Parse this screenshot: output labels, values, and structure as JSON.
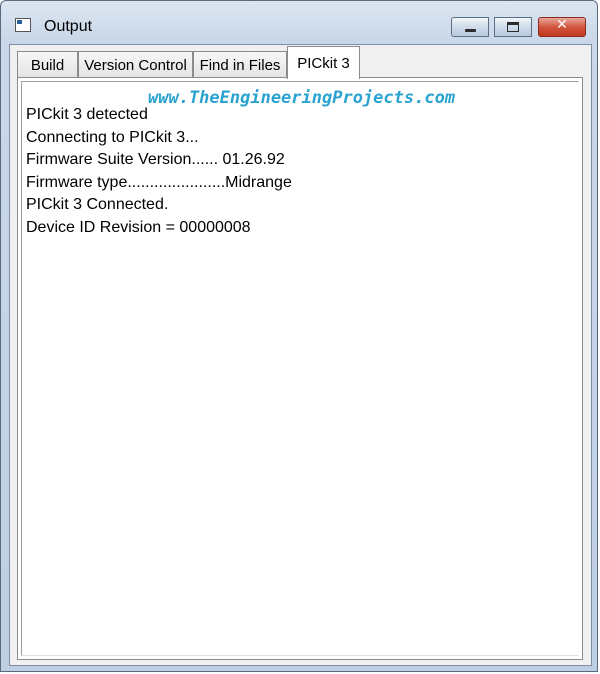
{
  "window": {
    "title": "Output",
    "icons": {
      "app": "app-window-icon",
      "minimize": "minimize-icon",
      "maximize": "maximize-icon",
      "close": "close-icon"
    },
    "close_glyph": "✕"
  },
  "tabs": [
    {
      "label": "Build",
      "active": false
    },
    {
      "label": "Version Control",
      "active": false
    },
    {
      "label": "Find in Files",
      "active": false
    },
    {
      "label": "PICkit 3",
      "active": true
    }
  ],
  "output": {
    "watermark": "www.TheEngineeringProjects.com",
    "lines": [
      "PICkit 3 detected",
      "Connecting to PICkit 3...",
      "Firmware Suite Version...... 01.26.92",
      "Firmware type......................Midrange",
      "PICkit 3 Connected.",
      "Device ID Revision = 00000008"
    ]
  },
  "colors": {
    "watermark": "#2aa3d0",
    "close_button": "#c1381f",
    "title_bar": "#c9d7e8"
  }
}
